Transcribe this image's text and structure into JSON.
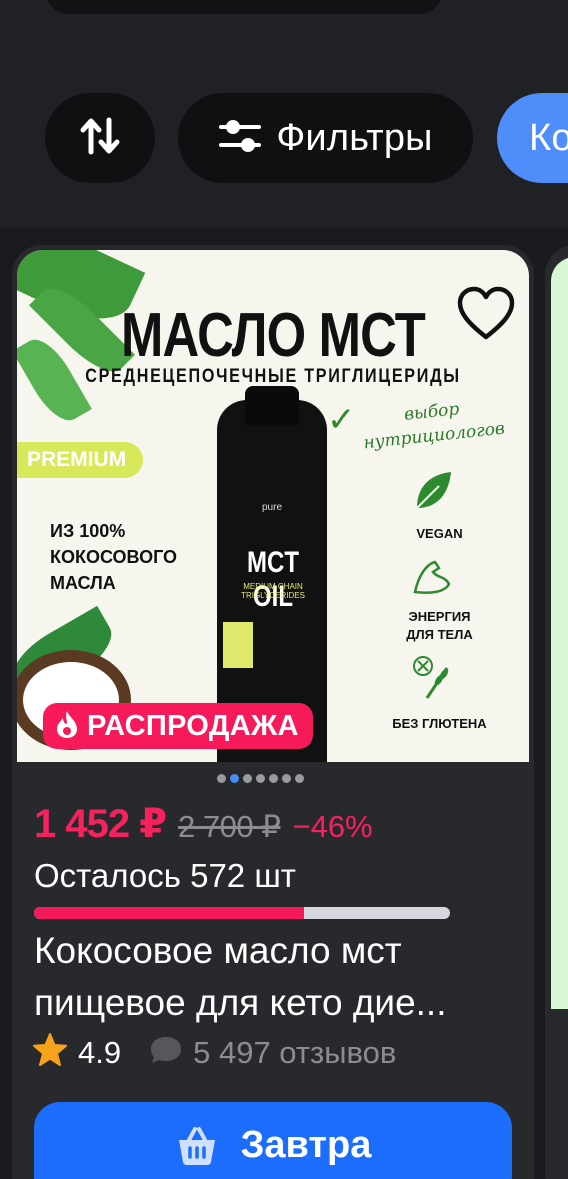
{
  "colors": {
    "background": "#1f2124",
    "card": "#28292d",
    "accent_blue": "#1c6dfb",
    "sale_pink": "#f61a5a",
    "muted_text": "#8c8d92",
    "rating_star": "#f7a21b"
  },
  "chips": {
    "sort_icon": "sort-arrows-icon",
    "filter_icon": "sliders-icon",
    "filter_label": "Фильтры",
    "category_label": "Ко"
  },
  "product": {
    "image": {
      "title": "МАСЛО МСТ",
      "subtitle": "СРЕДНЕЦЕПОЧЕЧНЫЕ ТРИГЛИЦЕРИДЫ",
      "premium": "PREMIUM",
      "from_text": "ИЗ 100%\nКОКОСОВОГО\nМАСЛА",
      "choice": "выбор\nнутрициологов",
      "bottle_brand": "pure",
      "bottle_label": "MCT OIL",
      "bottle_sub": "MEDIUM CHAIN TRIGLYCERIDES",
      "feature_1": "VEGAN",
      "feature_2": "ЭНЕРГИЯ\nДЛЯ ТЕЛА",
      "feature_3": "БЕЗ ГЛЮТЕНА"
    },
    "favorite_icon": "heart-outline-icon",
    "badge_icon": "flame-icon",
    "badge_label": "РАСПРОДАЖА",
    "gallery": {
      "count": 7,
      "active": 1
    },
    "price_current": "1 452 ₽",
    "price_old": "2 700 ₽",
    "discount": "−46%",
    "stock_text": "Осталось 572 шт",
    "stock_fraction": 0.65,
    "title_line_1": "Кокосовое масло мст",
    "title_line_2": "пищевое для кето дие...",
    "rating": "4.9",
    "reviews": "5 497 отзывов",
    "cart_icon": "basket-icon",
    "cart_label": "Завтра"
  }
}
